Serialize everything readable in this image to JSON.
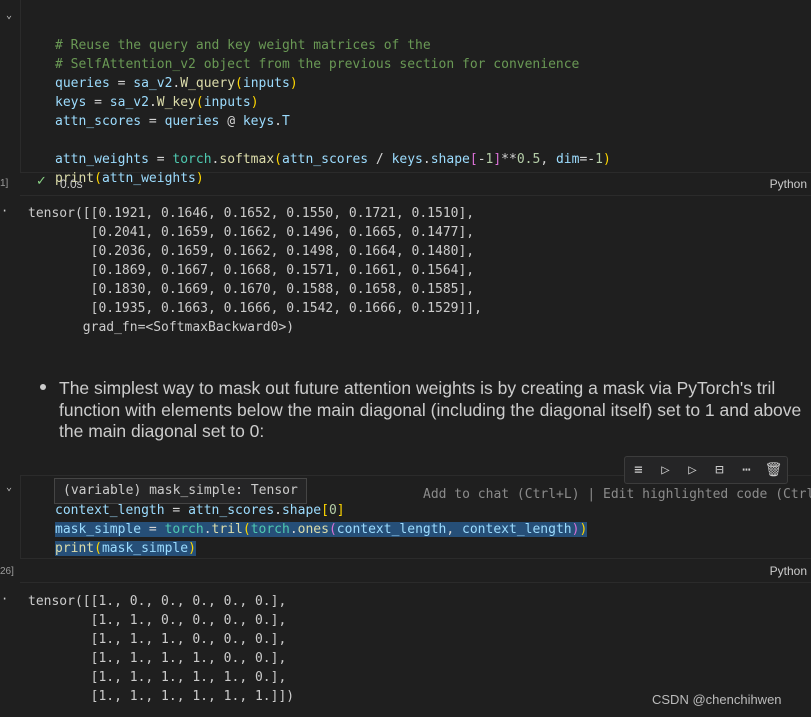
{
  "cell1": {
    "gutter_number": "1]",
    "lines": [
      "# Reuse the query and key weight matrices of the",
      "# SelfAttention_v2 object from the previous section for convenience"
    ],
    "status_time": "0.0s",
    "language": "Python"
  },
  "output1": {
    "lines": [
      "tensor([[0.1921, 0.1646, 0.1652, 0.1550, 0.1721, 0.1510],",
      "        [0.2041, 0.1659, 0.1662, 0.1496, 0.1665, 0.1477],",
      "        [0.2036, 0.1659, 0.1662, 0.1498, 0.1664, 0.1480],",
      "        [0.1869, 0.1667, 0.1668, 0.1571, 0.1661, 0.1564],",
      "        [0.1830, 0.1669, 0.1670, 0.1588, 0.1658, 0.1585],",
      "        [0.1935, 0.1663, 0.1666, 0.1542, 0.1666, 0.1529]],",
      "       grad_fn=<SoftmaxBackward0>)"
    ]
  },
  "markdown": {
    "text": "The simplest way to mask out future attention weights is by creating a mask via PyTorch's tril function with elements below the main diagonal (including the diagonal itself) set to 1 and above the main diagonal set to 0:"
  },
  "cell2": {
    "gutter_number": "26]",
    "hover_text": "(variable) mask_simple: Tensor",
    "hint_text": "Add to chat (Ctrl+L) | Edit highlighted code (Ctrl+",
    "language": "Python"
  },
  "output2": {
    "lines": [
      "tensor([[1., 0., 0., 0., 0., 0.],",
      "        [1., 1., 0., 0., 0., 0.],",
      "        [1., 1., 1., 0., 0., 0.],",
      "        [1., 1., 1., 1., 0., 0.],",
      "        [1., 1., 1., 1., 1., 0.],",
      "        [1., 1., 1., 1., 1., 1.]])"
    ]
  },
  "toolbar_icons": [
    "run-by-line-icon",
    "execute-above-icon",
    "execute-below-icon",
    "split-cell-icon",
    "more-icon",
    "delete-icon"
  ],
  "watermark": "CSDN @chenchihwen"
}
